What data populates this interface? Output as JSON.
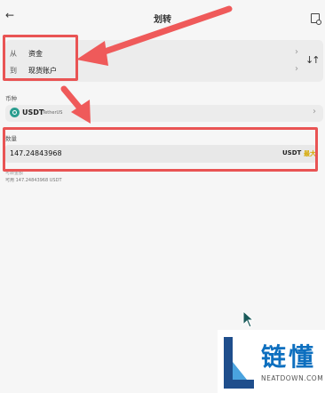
{
  "header": {
    "title": "划转"
  },
  "transfer": {
    "from_label": "从",
    "from_value": "资金",
    "to_label": "到",
    "to_value": "现货账户"
  },
  "coin": {
    "section_label": "币种",
    "symbol": "USDT",
    "full_name": "TetherUS"
  },
  "amount": {
    "section_label": "数量",
    "value": "147.24843968",
    "unit": "USDT",
    "max_label": "最大"
  },
  "info": {
    "transfer_limit": "可转金额",
    "available": "可用 147.24843968 USDT"
  },
  "watermark": {
    "title": "链懂",
    "subtitle": "NEATDOWN.COM"
  },
  "colors": {
    "highlight": "#e95454",
    "max_button": "#d6a800",
    "coin_logo": "#2a9d8f",
    "watermark_blue": "#0d6fbf"
  },
  "icons": [
    "back-arrow-icon",
    "record-icon",
    "chevron-right-icon",
    "swap-arrows-icon",
    "cursor-icon"
  ]
}
